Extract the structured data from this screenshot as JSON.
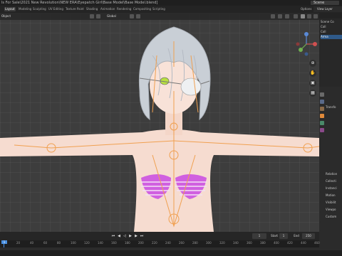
{
  "titlebar": {
    "title": "ls For Sale\\2021 New Revolution\\NEW ERA\\Eyepatch Girl\\Base Model\\Base Model.blend]",
    "scene": "Scene"
  },
  "workspaces": {
    "tabs": [
      "Layout",
      "Modeling",
      "Sculpting",
      "UV Editing",
      "Texture Paint",
      "Shading",
      "Animation",
      "Rendering",
      "Compositing",
      "Scripting"
    ],
    "active": "Layout",
    "options_label": "Options",
    "view_layer": "View Layer"
  },
  "viewport": {
    "object_mode": "Object",
    "transform_orientation": "Global"
  },
  "outliner": {
    "rows": [
      "Scene Co",
      "Coll",
      "Coll",
      "Arma"
    ],
    "selected_index": 3
  },
  "properties": {
    "rows": [
      "Transfo",
      "Relation",
      "Collecti",
      "Instanci",
      "Motion",
      "Visibilit",
      "Viewpo",
      "Custom"
    ]
  },
  "timeline": {
    "current_frame": "1",
    "start_label": "Start",
    "start_value": "1",
    "end_label": "End",
    "end_value": "250",
    "ruler_ticks": [
      "0",
      "20",
      "40",
      "60",
      "80",
      "100",
      "120",
      "140",
      "160",
      "180",
      "200",
      "220",
      "240",
      "260",
      "280",
      "300",
      "320",
      "340",
      "360",
      "380",
      "400",
      "420",
      "440",
      "460"
    ]
  },
  "colors": {
    "accent": "#4a90e2",
    "bone": "#f0a050",
    "hair": "#c9cfd6",
    "skin": "#f6dcd0",
    "bikini": "#d060e0",
    "selection": "#2f5a8a"
  }
}
